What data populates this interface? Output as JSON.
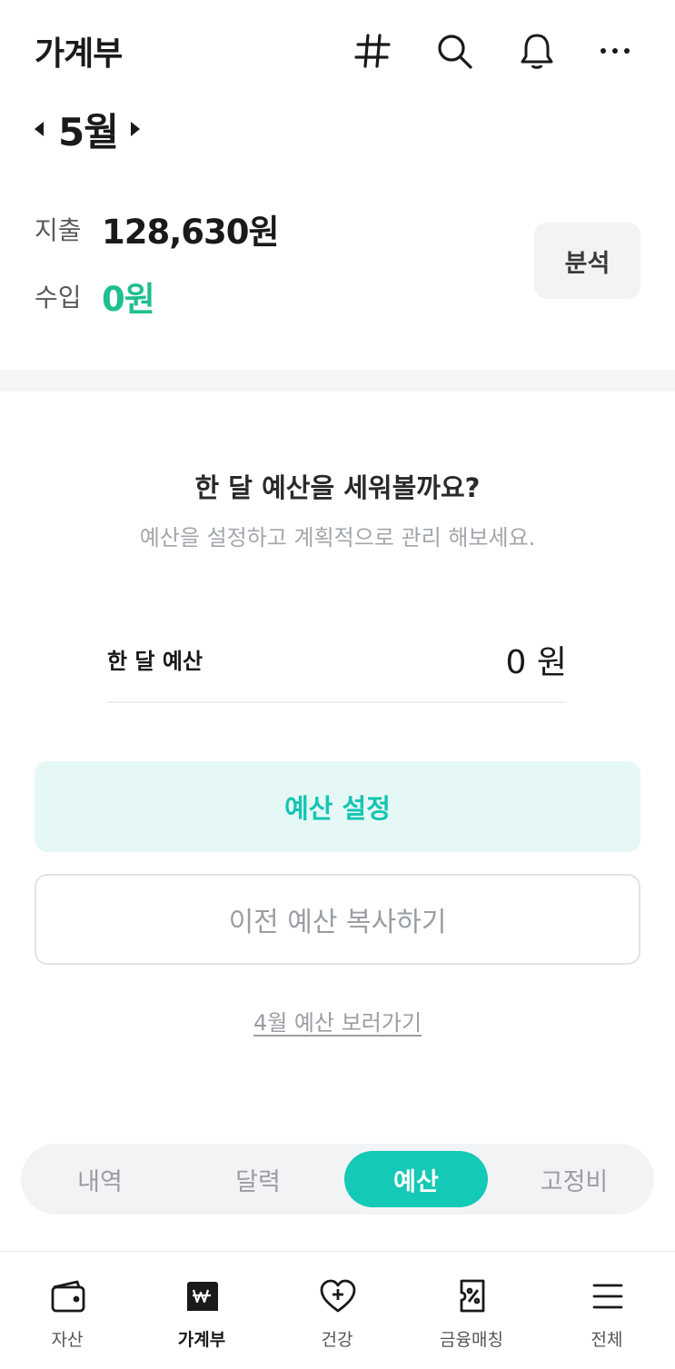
{
  "header": {
    "title": "가계부",
    "icons": [
      "hashtag-icon",
      "search-icon",
      "bell-icon",
      "more-icon"
    ]
  },
  "month": {
    "label": "5월"
  },
  "summary": {
    "expense_label": "지출",
    "expense_value": "128,630원",
    "income_label": "수입",
    "income_value": "0원",
    "analysis_button": "분석"
  },
  "budget": {
    "title": "한 달 예산을 세워볼까요?",
    "subtitle": "예산을 설정하고 계획적으로 관리 해보세요.",
    "monthly_label": "한 달 예산",
    "monthly_value": "0 원",
    "set_button": "예산 설정",
    "copy_button": "이전 예산 복사하기",
    "prev_link": "4월 예산 보러가기"
  },
  "segment": {
    "tabs": [
      {
        "label": "내역"
      },
      {
        "label": "달력"
      },
      {
        "label": "예산"
      },
      {
        "label": "고정비"
      }
    ],
    "active": "예산"
  },
  "bottom_nav": {
    "items": [
      {
        "label": "자산",
        "icon": "wallet-icon"
      },
      {
        "label": "가계부",
        "icon": "ledger-icon"
      },
      {
        "label": "건강",
        "icon": "heart-plus-icon"
      },
      {
        "label": "금융매칭",
        "icon": "coupon-icon"
      },
      {
        "label": "전체",
        "icon": "menu-icon"
      }
    ],
    "active": "가계부"
  },
  "colors": {
    "accent": "#14c9b5",
    "income_green": "#1fbf8f",
    "set_button_bg": "#e5f8f6"
  }
}
